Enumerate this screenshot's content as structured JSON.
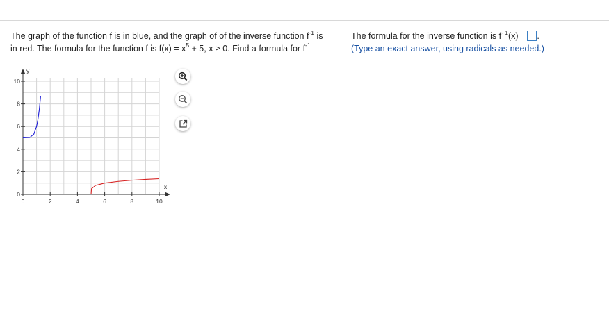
{
  "question": {
    "line1_a": "The graph of the function f is in blue, and the graph of of the inverse function f",
    "line1_sup": "-1",
    "line1_b": " is",
    "line2_a": "in red. The formula for the function f is f(x) = x",
    "line2_sup": "5",
    "line2_b": " + 5, x ≥ 0. Find a formula for f",
    "line2_sup2": "-1"
  },
  "answer": {
    "prefix": "The formula for the inverse function is f",
    "prefix_sup": "- 1",
    "suffix": "(x) =",
    "end": ".",
    "hint": "(Type an exact answer, using radicals as needed.)"
  },
  "tools": {
    "zoom_in_icon": "zoom-in-icon",
    "zoom_out_icon": "zoom-out-icon",
    "popout_icon": "popout-icon"
  },
  "chart_data": {
    "type": "line",
    "xlabel": "x",
    "ylabel": "y",
    "xlim": [
      0,
      10
    ],
    "ylim": [
      0,
      10
    ],
    "x_ticks": [
      "0",
      "2",
      "4",
      "6",
      "8",
      "10"
    ],
    "y_ticks": [
      "0",
      "2",
      "4",
      "6",
      "8",
      "10"
    ],
    "grid": true,
    "series": [
      {
        "color": "#1b1bd6",
        "x": [
          0,
          0.5,
          0.8,
          1.0,
          1.1,
          1.2,
          1.3
        ],
        "y": [
          5,
          5.03,
          5.33,
          6,
          6.61,
          7.49,
          8.71
        ]
      },
      {
        "color": "#d62020",
        "x": [
          5,
          5.03,
          5.33,
          6,
          7,
          8,
          9,
          10
        ],
        "y": [
          0,
          0.5,
          0.8,
          1.0,
          1.15,
          1.25,
          1.32,
          1.38
        ]
      }
    ]
  }
}
